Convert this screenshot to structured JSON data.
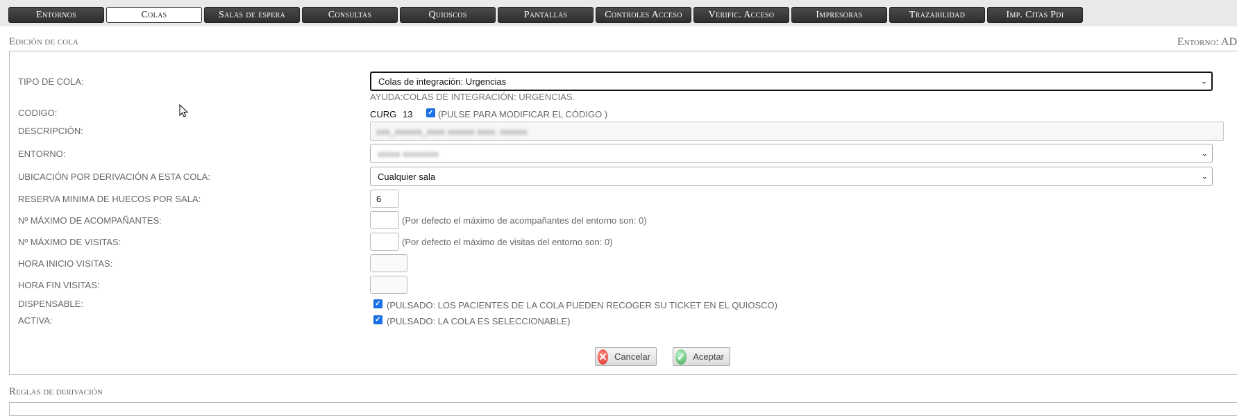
{
  "tabs": [
    {
      "label": "Entornos",
      "active": false
    },
    {
      "label": "Colas",
      "active": true
    },
    {
      "label": "Salas de espera",
      "active": false
    },
    {
      "label": "Consultas",
      "active": false
    },
    {
      "label": "Quioscos",
      "active": false
    },
    {
      "label": "Pantallas",
      "active": false
    },
    {
      "label": "Controles Acceso",
      "active": false
    },
    {
      "label": "Verific. Acceso",
      "active": false
    },
    {
      "label": "Impresoras",
      "active": false
    },
    {
      "label": "Trazabilidad",
      "active": false
    },
    {
      "label": "Imp. Citas Pdi",
      "active": false
    }
  ],
  "section": {
    "title": "Edición de cola",
    "environment_label": "Entorno: AD",
    "rules_title": "Reglas de derivación"
  },
  "form": {
    "tipo_cola": {
      "label": "TIPO DE COLA:",
      "value": "Colas de integración: Urgencias"
    },
    "ayuda": "AYUDA:COLAS DE INTEGRACIÓN: URGENCIAS.",
    "codigo": {
      "label": "CODIGO:",
      "prefix": "CURG",
      "number": "13",
      "checked": true,
      "hint": "(PULSE PARA MODIFICAR EL CÓDIGO )"
    },
    "descripcion": {
      "label": "DESCRIPCIÓN:",
      "value": "xxx_xxxxxx_xxxx xxxxxx xxxx. xxxxxx"
    },
    "entorno": {
      "label": "ENTORNO:",
      "value": "xxxxx xxxxxxxx"
    },
    "ubicacion": {
      "label": "UBICACIÓN POR DERIVACIÓN A ESTA COLA:",
      "value": "Cualquier sala"
    },
    "reserva": {
      "label": "RESERVA MINIMA DE HUECOS POR SALA:",
      "value": "6"
    },
    "max_acomp": {
      "label": "Nº MÁXIMO DE ACOMPAÑANTES:",
      "value": "",
      "hint": "(Por defecto el máximo de acompañantes del entorno son: 0)"
    },
    "max_visitas": {
      "label": "Nº MÁXIMO DE VISITAS:",
      "value": "",
      "hint": "(Por defecto el máximo de visitas del entorno son: 0)"
    },
    "hora_inicio": {
      "label": "HORA INICIO VISITAS:",
      "value": ""
    },
    "hora_fin": {
      "label": "HORA FIN VISITAS:",
      "value": ""
    },
    "dispensable": {
      "label": "DISPENSABLE:",
      "checked": true,
      "hint": "(PULSADO: LOS PACIENTES DE LA COLA PUEDEN RECOGER SU TICKET EN EL QUIOSCO)"
    },
    "activa": {
      "label": "ACTIVA:",
      "checked": true,
      "hint": "(PULSADO: LA COLA ES SELECCIONABLE)"
    }
  },
  "buttons": {
    "cancel": "Cancelar",
    "accept": "Aceptar"
  },
  "icons": {
    "cancel": "x-circle-red-icon",
    "accept": "check-circle-green-icon",
    "checkbox": "checkmark",
    "select": "chevron-down-icon"
  },
  "colors": {
    "tab_bg": "#3a3a3a",
    "checkbox": "#1a73e8",
    "cancel_icon": "#e0483e",
    "accept_icon": "#4caf50"
  }
}
